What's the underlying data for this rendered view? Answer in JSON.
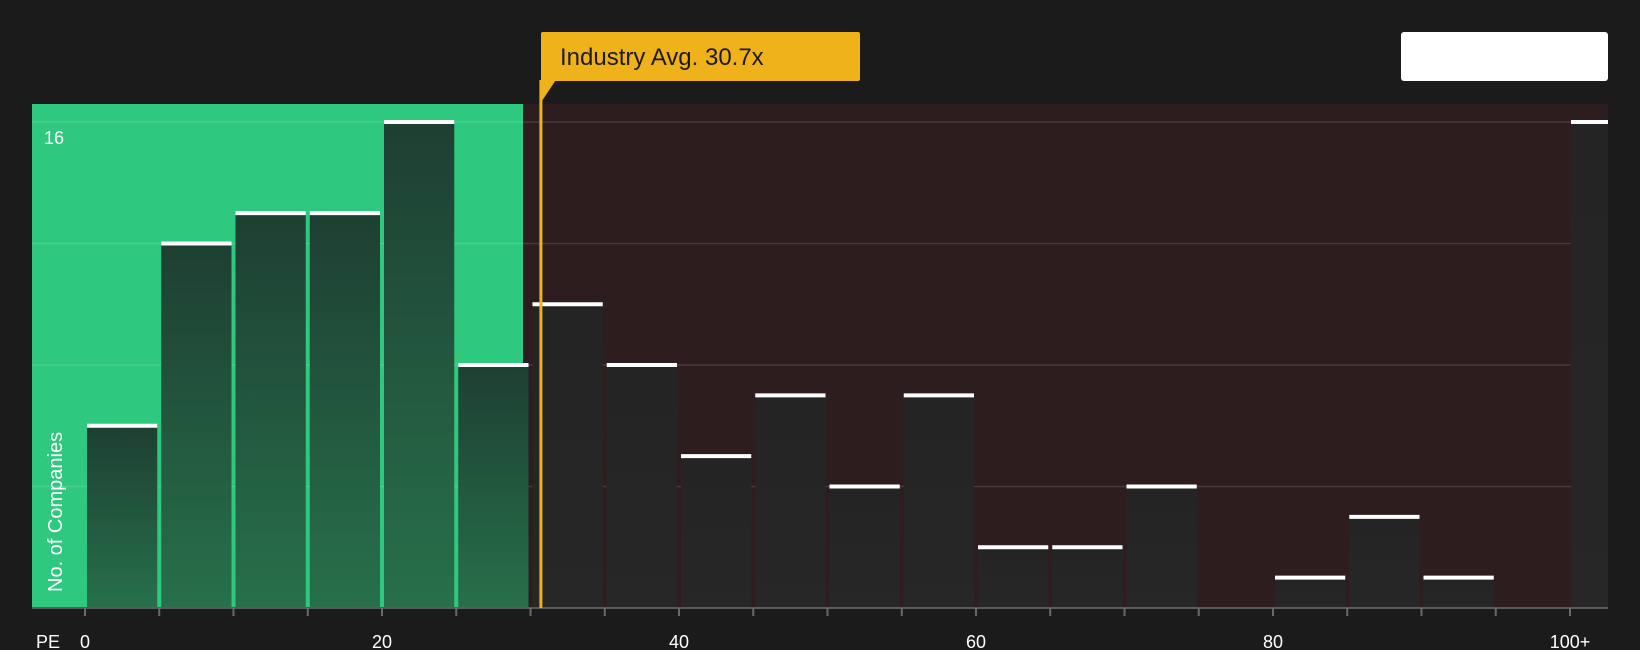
{
  "chart_data": {
    "type": "bar",
    "xlabel": "PE",
    "ylabel": "No. of Companies",
    "xlim": [
      0,
      100
    ],
    "ylim": [
      0,
      16
    ],
    "y_labeled_ticks": [
      "16"
    ],
    "grid": true,
    "x_ticks": [
      {
        "value": 0,
        "label": "0"
      },
      {
        "value": 20,
        "label": "20"
      },
      {
        "value": 40,
        "label": "40"
      },
      {
        "value": 60,
        "label": "60"
      },
      {
        "value": 80,
        "label": "80"
      },
      {
        "value": 100,
        "label": "100+"
      }
    ],
    "bin_width": 5,
    "bins": [
      {
        "start": 0,
        "end": 5,
        "count": 6
      },
      {
        "start": 5,
        "end": 10,
        "count": 12
      },
      {
        "start": 10,
        "end": 15,
        "count": 13
      },
      {
        "start": 15,
        "end": 20,
        "count": 13
      },
      {
        "start": 20,
        "end": 25,
        "count": 16
      },
      {
        "start": 25,
        "end": 30,
        "count": 8
      },
      {
        "start": 30,
        "end": 35,
        "count": 10
      },
      {
        "start": 35,
        "end": 40,
        "count": 8
      },
      {
        "start": 40,
        "end": 45,
        "count": 5
      },
      {
        "start": 45,
        "end": 50,
        "count": 7
      },
      {
        "start": 50,
        "end": 55,
        "count": 4
      },
      {
        "start": 55,
        "end": 60,
        "count": 7
      },
      {
        "start": 60,
        "end": 65,
        "count": 2
      },
      {
        "start": 65,
        "end": 70,
        "count": 2
      },
      {
        "start": 70,
        "end": 75,
        "count": 4
      },
      {
        "start": 75,
        "end": 80,
        "count": 0
      },
      {
        "start": 80,
        "end": 85,
        "count": 1
      },
      {
        "start": 85,
        "end": 90,
        "count": 3
      },
      {
        "start": 90,
        "end": 95,
        "count": 1
      },
      {
        "start": 95,
        "end": 100,
        "count": 0
      },
      {
        "start": 100,
        "end": 105,
        "count": 16
      }
    ],
    "highlight_range": [
      0,
      29.5
    ],
    "industry_average": {
      "value": 30.7,
      "label": "Industry Avg. 30.7x"
    },
    "colors": {
      "background": "#1b1b1b",
      "highlight": "#2ec87e",
      "right_region": "#2e1d1f",
      "average_line": "#f0b21b",
      "bar_cap": "#ffffff"
    }
  }
}
